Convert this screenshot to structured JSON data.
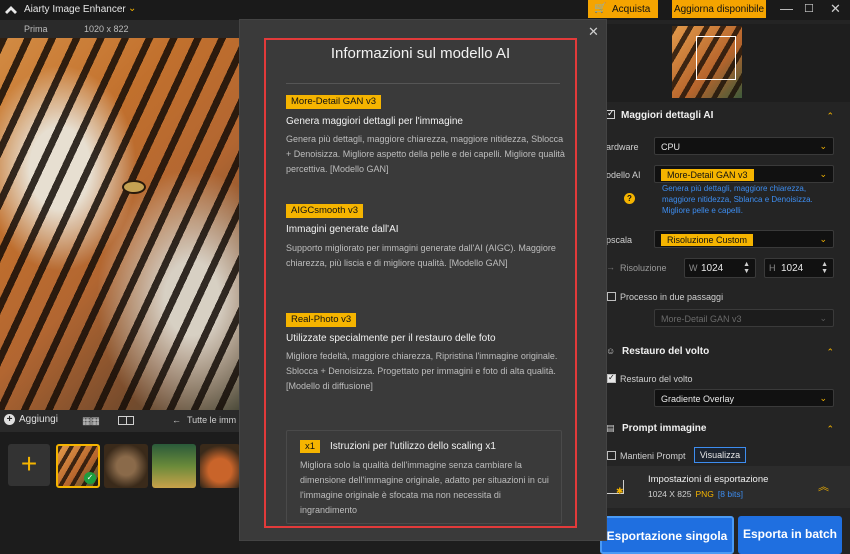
{
  "app": {
    "title": "Aiarty Image Enhancer",
    "buy_label": "Acquista",
    "update_label": "Aggiorna disponibile"
  },
  "colors": {
    "accent": "#f5b400",
    "primary_blue": "#1f6fe0",
    "link_blue": "#3d8df0",
    "highlight_red": "#e23a3a"
  },
  "preview": {
    "mode_label": "Prima",
    "size_label": "1020 x 822"
  },
  "bottom_toolbar": {
    "add_label": "Aggiungi",
    "all_images_label": "Tutte le imm"
  },
  "modal": {
    "title": "Informazioni sul modello AI",
    "models": [
      {
        "tag": "More-Detail GAN v3",
        "name": "Genera maggiori dettagli per l'immagine",
        "desc": "Genera più dettagli, maggiore chiarezza, maggiore nitidezza, Sblocca + Denoisizza. Migliore aspetto della pelle e dei capelli. Migliore qualità percettiva. [Modello GAN]"
      },
      {
        "tag": "AIGCsmooth v3",
        "name": "Immagini generate dall'AI",
        "desc": "Supporto migliorato per immagini generate dall'AI (AIGC). Maggiore chiarezza, più liscia e di migliore qualità. [Modello GAN]"
      },
      {
        "tag": "Real-Photo v3",
        "name": "Utilizzate specialmente per il restauro delle foto",
        "desc": "Migliore fedeltà, maggiore chiarezza, Ripristina l'immagine originale. Sblocca + Denoisizza. Progettato per immagini e foto di alta qualità. [Modello di diffusione]"
      }
    ],
    "scale": {
      "tag": "x1",
      "title": "Istruzioni per l'utilizzo dello scaling x1",
      "desc": "Migliora solo la qualità dell'immagine senza cambiare la dimensione dell'immagine originale, adatto per situazioni in cui l'immagine originale è sfocata ma non necessita di ingrandimento"
    }
  },
  "panel": {
    "details_title": "Maggiori dettagli AI",
    "hardware_label": "ardware",
    "hardware_value": "CPU",
    "model_label": "odello AI",
    "model_value": "More-Detail GAN  v3",
    "model_desc": "Genera più dettagli, maggiore chiarezza, maggiore nitidezza, Sblanca e Denoisizza. Migliore pelle e capelli.",
    "upscale_label": "pscala",
    "upscale_value": "Risoluzione Custom",
    "resolution_label": "Risoluzione",
    "width_axis": "W",
    "width_value": "1024",
    "height_axis": "H",
    "height_value": "1024",
    "two_pass_label": "Processo in due passaggi",
    "two_pass_model": "More-Detail GAN  v3",
    "face_title": "Restauro del volto",
    "face_check_label": "Restauro del volto",
    "face_mode": "Gradiente Overlay",
    "prompt_title": "Prompt immagine",
    "keep_prompt_label": "Mantieni Prompt",
    "visualize_label": "Visualizza",
    "export_title": "Impostazioni di esportazione",
    "export_size": "1024 X 825",
    "export_format": "PNG",
    "export_bits": "[8 bits]",
    "single_export_label": "Esportazione singola",
    "batch_export_label": "Esporta in batch"
  }
}
